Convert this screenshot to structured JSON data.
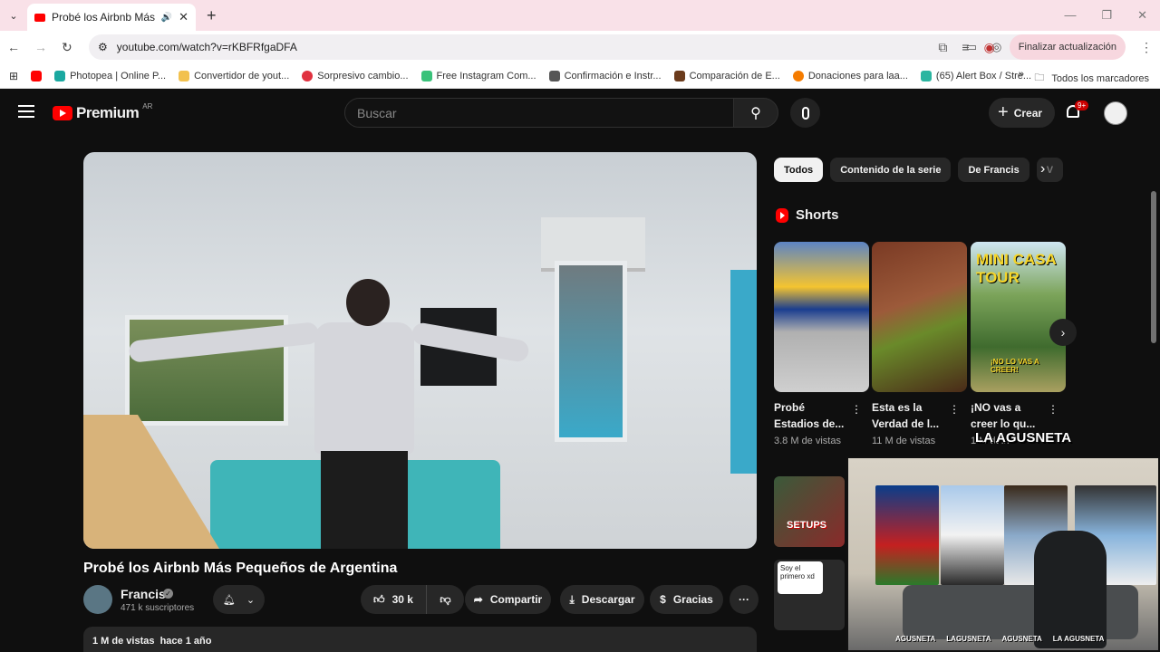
{
  "browser": {
    "tab_title": "Probé los Airbnb Más Pequ",
    "url": "youtube.com/watch?v=rKBFRfgaDFA",
    "update_button": "Finalizar actualización",
    "bookmarks": [
      {
        "label": "Photopea | Online P...",
        "color": "#1aa8a0"
      },
      {
        "label": "Convertidor de yout...",
        "color": "#f2c14e"
      },
      {
        "label": "Sorpresivo cambio...",
        "color": "#e0313f"
      },
      {
        "label": "Free Instagram Com...",
        "color": "#3ac27a"
      },
      {
        "label": "Confirmación e Instr...",
        "color": "#555555"
      },
      {
        "label": "Comparación de E...",
        "color": "#6b3b1c"
      },
      {
        "label": "Donaciones para laa...",
        "color": "#f57c00"
      },
      {
        "label": "(65) Alert Box / Stre...",
        "color": "#2bb5a0"
      }
    ],
    "all_bookmarks": "Todos los marcadores"
  },
  "header": {
    "logo_text": "Premium",
    "country": "AR",
    "search_placeholder": "Buscar",
    "create_label": "Crear",
    "notif_count": "9+"
  },
  "video": {
    "title": "Probé los Airbnb Más Pequeños de Argentina",
    "channel": "Francis",
    "subscribers": "471 k suscriptores",
    "likes": "30 k",
    "share": "Compartir",
    "download": "Descargar",
    "thanks": "Gracias",
    "meta": "1 M de vistas  hace 1 año"
  },
  "chips": [
    "Todos",
    "Contenido de la serie",
    "De Francis",
    "V"
  ],
  "shorts": {
    "heading": "Shorts",
    "items": [
      {
        "title": "Probé Estadios de...",
        "views": "3.8 M de vistas"
      },
      {
        "title": "Esta es la Verdad de l...",
        "views": "11 M de vistas"
      },
      {
        "title": "¡NO vas a creer lo qu...",
        "views": "1 M de..."
      }
    ],
    "item3_overlay": "MINI CASA TOUR",
    "item3_sub": "¡NO LO VAS A CREER!"
  },
  "recs": {
    "rec1_overlay": "SETUPS",
    "rec2_bubble": "Soy el primero xd"
  },
  "webcam": {
    "watermark": "LA AGUSNETA",
    "socials": [
      "AGUSNETA",
      "LAGUSNETA",
      "AGUSNETA",
      "LA AGUSNETA"
    ]
  }
}
